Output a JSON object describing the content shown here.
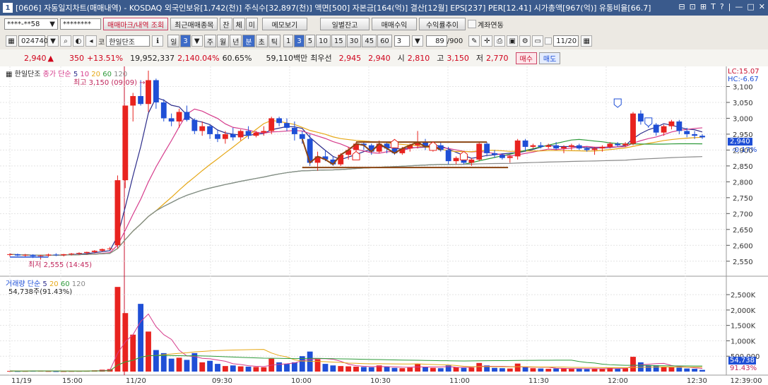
{
  "window": {
    "num": "1",
    "title": "[0606] 자동일지차트(매매내역) - KOSDAQ 외국인보유[1,742(천)] 주식수[32,897(천)] 액면[500] 자본금[164(억)] 결산[12월] EPS[237] PER[12.41] 시가총액[967(억)] 유통비율[66.7]",
    "controls": [
      "⊟",
      "⊡",
      "⊞",
      "T",
      "?",
      "|",
      "—",
      "□",
      "✕"
    ]
  },
  "toolbar1": {
    "account": "****-**58",
    "password": "********",
    "btn_trade_mark": "매매마크/내역 조회",
    "btn_recent": "최근매매종목",
    "btn_jan": "잔",
    "btn_che": "체",
    "btn_mi": "미",
    "btn_memo": "메모보기",
    "btn_daily": "일별잔고",
    "btn_profit": "매매수익",
    "btn_rate": "수익률추이",
    "chk_account": "계좌연동"
  },
  "toolbar2": {
    "code": "024740",
    "kind": "코",
    "name": "한일단조",
    "periods": [
      "일",
      "3",
      "주",
      "월",
      "년",
      "분",
      "초",
      "틱"
    ],
    "period_selected": "분",
    "minutes": [
      "1",
      "3",
      "5",
      "10",
      "15",
      "30",
      "45",
      "60"
    ],
    "minute_selected": "3",
    "count": "3",
    "range": "89",
    "total": "/900",
    "date": "11/20"
  },
  "quote": {
    "price": "2,940",
    "arrow": "▲",
    "change": "350",
    "change_pct": "+13.51%",
    "volume": "19,952,337",
    "vol_pct": "2,140.04%",
    "turnover": "60.65%",
    "amount": "59,110백만",
    "best_ask_label": "최우선",
    "best_ask": "2,945",
    "best_bid": "2,940",
    "open_label": "시",
    "open": "2,810",
    "high_label": "고",
    "high": "3,150",
    "low_label": "저",
    "low": "2,770",
    "buy": "매수",
    "sell": "매도"
  },
  "legend_price": {
    "name": "한일단조",
    "ma_label": "종가 단순",
    "ma": [
      "5",
      "10",
      "20",
      "60",
      "120"
    ],
    "max_label": "최고 3,150 (09:09)",
    "min_label": "최저 2,555 (14:45)",
    "lc": "LC:15.07",
    "hc": "HC:-6.67"
  },
  "legend_volume": {
    "label": "거래량 단순",
    "ma": [
      "5",
      "20",
      "60",
      "120"
    ],
    "value": "54,738주(91.43%)",
    "last_value": "54,738",
    "last_pct": "91.43%"
  },
  "colors": {
    "up": "#e8231f",
    "down": "#1f4fd6",
    "ma5": "#2c2c8a",
    "ma10": "#d63c8c",
    "ma20": "#e6a817",
    "ma60": "#2e9a3a",
    "ma120": "#8a8a8a",
    "pattern": "#8b4513"
  },
  "chart_data": {
    "type": "candlestick",
    "price_ticks": [
      "3,100",
      "3,050",
      "3,000",
      "2,950",
      "2,900",
      "2,850",
      "2,800",
      "2,750",
      "2,700",
      "2,650",
      "2,600",
      "2,550"
    ],
    "volume_ticks": [
      "2,500K",
      "2,000K",
      "1,500K",
      "1,000K",
      "500,000"
    ],
    "x_labels": [
      "11/19",
      "15:00",
      "11/20",
      "09:30",
      "10:00",
      "10:30",
      "11:00",
      "11:30",
      "12:00",
      "12:30",
      "12:39:00"
    ],
    "last_price": "2,940",
    "last_pct": "-0.17%",
    "price_range": [
      2525,
      3150
    ],
    "volume_range": [
      0,
      2800000
    ],
    "candles": [
      [
        2570,
        2575,
        2565,
        2572,
        20000
      ],
      [
        2572,
        2574,
        2566,
        2568,
        15000
      ],
      [
        2568,
        2573,
        2563,
        2570,
        18000
      ],
      [
        2570,
        2572,
        2560,
        2566,
        22000
      ],
      [
        2566,
        2570,
        2555,
        2568,
        30000
      ],
      [
        2568,
        2574,
        2564,
        2571,
        16000
      ],
      [
        2571,
        2575,
        2566,
        2569,
        12000
      ],
      [
        2569,
        2573,
        2565,
        2572,
        14000
      ],
      [
        2572,
        2576,
        2568,
        2574,
        17000
      ],
      [
        2574,
        2578,
        2570,
        2576,
        19000
      ],
      [
        2576,
        2580,
        2571,
        2579,
        21000
      ],
      [
        2579,
        2585,
        2575,
        2583,
        40000
      ],
      [
        2583,
        2590,
        2580,
        2588,
        60000
      ],
      [
        2588,
        2595,
        2585,
        2590,
        80000
      ],
      [
        2600,
        2820,
        2590,
        2805,
        2750000
      ],
      [
        2805,
        3040,
        2780,
        3040,
        1900000
      ],
      [
        3040,
        3080,
        2990,
        3070,
        1200000
      ],
      [
        3070,
        3120,
        3040,
        3045,
        2200000
      ],
      [
        3045,
        3150,
        3020,
        3120,
        1300000
      ],
      [
        3120,
        3125,
        3030,
        3050,
        700000
      ],
      [
        3050,
        3060,
        2990,
        3000,
        600000
      ],
      [
        3000,
        3015,
        2975,
        2990,
        420000
      ],
      [
        2990,
        3030,
        2970,
        3020,
        450000
      ],
      [
        3020,
        3040,
        2990,
        2995,
        380000
      ],
      [
        2995,
        3000,
        2950,
        2960,
        600000
      ],
      [
        2960,
        2990,
        2945,
        2975,
        300000
      ],
      [
        2975,
        2980,
        2935,
        2950,
        350000
      ],
      [
        2950,
        2965,
        2925,
        2935,
        250000
      ],
      [
        2935,
        2960,
        2920,
        2950,
        180000
      ],
      [
        2950,
        2970,
        2930,
        2940,
        200000
      ],
      [
        2940,
        2965,
        2930,
        2960,
        170000
      ],
      [
        2960,
        2975,
        2935,
        2945,
        160000
      ],
      [
        2945,
        2960,
        2940,
        2955,
        150000
      ],
      [
        2955,
        2975,
        2945,
        2960,
        140000
      ],
      [
        2960,
        3005,
        2950,
        3000,
        420000
      ],
      [
        3000,
        3005,
        2975,
        2985,
        300000
      ],
      [
        2985,
        3000,
        2960,
        2970,
        250000
      ],
      [
        2970,
        2990,
        2930,
        2950,
        300000
      ],
      [
        2950,
        2960,
        2920,
        2935,
        500000
      ],
      [
        2935,
        2950,
        2850,
        2860,
        650000
      ],
      [
        2860,
        2895,
        2835,
        2880,
        400000
      ],
      [
        2880,
        2900,
        2865,
        2870,
        250000
      ],
      [
        2870,
        2880,
        2850,
        2855,
        200000
      ],
      [
        2855,
        2890,
        2850,
        2885,
        180000
      ],
      [
        2885,
        2910,
        2870,
        2900,
        170000
      ],
      [
        2900,
        2925,
        2895,
        2920,
        160000
      ],
      [
        2920,
        2925,
        2900,
        2915,
        150000
      ],
      [
        2915,
        2920,
        2885,
        2895,
        140000
      ],
      [
        2895,
        2930,
        2890,
        2920,
        200000
      ],
      [
        2920,
        2925,
        2890,
        2905,
        150000
      ],
      [
        2905,
        2915,
        2885,
        2890,
        120000
      ],
      [
        2890,
        2910,
        2885,
        2905,
        110000
      ],
      [
        2905,
        2920,
        2895,
        2915,
        130000
      ],
      [
        2915,
        2960,
        2905,
        2925,
        250000
      ],
      [
        2925,
        2935,
        2900,
        2910,
        140000
      ],
      [
        2910,
        2925,
        2895,
        2915,
        120000
      ],
      [
        2915,
        2925,
        2895,
        2900,
        110000
      ],
      [
        2900,
        2910,
        2855,
        2865,
        200000
      ],
      [
        2865,
        2880,
        2855,
        2875,
        140000
      ],
      [
        2875,
        2880,
        2855,
        2860,
        120000
      ],
      [
        2860,
        2875,
        2850,
        2870,
        130000
      ],
      [
        2870,
        2925,
        2865,
        2920,
        280000
      ],
      [
        2920,
        2925,
        2880,
        2890,
        200000
      ],
      [
        2890,
        2900,
        2875,
        2885,
        120000
      ],
      [
        2885,
        2890,
        2870,
        2875,
        110000
      ],
      [
        2875,
        2885,
        2860,
        2880,
        100000
      ],
      [
        2880,
        2935,
        2870,
        2930,
        260000
      ],
      [
        2930,
        2935,
        2895,
        2910,
        140000
      ],
      [
        2910,
        2920,
        2905,
        2915,
        110000
      ],
      [
        2915,
        2925,
        2905,
        2910,
        100000
      ],
      [
        2910,
        2920,
        2905,
        2915,
        90000
      ],
      [
        2915,
        2925,
        2900,
        2905,
        100000
      ],
      [
        2905,
        2915,
        2890,
        2910,
        110000
      ],
      [
        2910,
        2920,
        2900,
        2915,
        90000
      ],
      [
        2915,
        2920,
        2900,
        2905,
        100000
      ],
      [
        2905,
        2910,
        2895,
        2900,
        80000
      ],
      [
        2900,
        2910,
        2885,
        2905,
        100000
      ],
      [
        2905,
        2915,
        2895,
        2910,
        90000
      ],
      [
        2910,
        2925,
        2905,
        2920,
        120000
      ],
      [
        2920,
        2925,
        2910,
        2915,
        100000
      ],
      [
        2915,
        2925,
        2910,
        2920,
        110000
      ],
      [
        2920,
        3020,
        2915,
        3015,
        480000
      ],
      [
        3015,
        3025,
        2980,
        2990,
        300000
      ],
      [
        2990,
        3000,
        2970,
        2980,
        200000
      ],
      [
        2980,
        2985,
        2945,
        2955,
        200000
      ],
      [
        2955,
        2980,
        2945,
        2975,
        150000
      ],
      [
        2975,
        2995,
        2965,
        2990,
        140000
      ],
      [
        2990,
        2995,
        2950,
        2960,
        130000
      ],
      [
        2960,
        2970,
        2940,
        2950,
        100000
      ],
      [
        2950,
        2960,
        2935,
        2945,
        90000
      ],
      [
        2945,
        2950,
        2935,
        2940,
        54738
      ]
    ]
  }
}
